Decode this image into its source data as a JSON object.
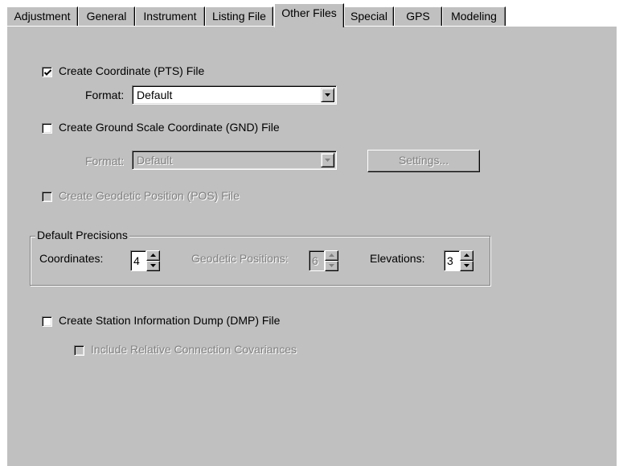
{
  "tabs": [
    {
      "label": "Adjustment"
    },
    {
      "label": "General"
    },
    {
      "label": "Instrument"
    },
    {
      "label": "Listing File"
    },
    {
      "label": "Other Files"
    },
    {
      "label": "Special"
    },
    {
      "label": "GPS"
    },
    {
      "label": "Modeling"
    }
  ],
  "active_tab": "Other Files",
  "pts": {
    "label": "Create Coordinate (PTS) File",
    "checked": true,
    "format_label": "Format:",
    "format_value": "Default"
  },
  "gnd": {
    "label": "Create Ground Scale Coordinate (GND) File",
    "checked": false,
    "format_label": "Format:",
    "format_value": "Default",
    "settings_label": "Settings..."
  },
  "pos": {
    "label": "Create Geodetic Position (POS) File",
    "checked": false,
    "disabled": true
  },
  "precisions": {
    "legend": "Default Precisions",
    "coordinates_label": "Coordinates:",
    "coordinates_value": "4",
    "geodetic_label": "Geodetic Positions:",
    "geodetic_value": "6",
    "elevations_label": "Elevations:",
    "elevations_value": "3"
  },
  "dmp": {
    "label": "Create Station Information Dump (DMP) File",
    "checked": false,
    "include_label": "Include Relative Connection Covariances",
    "include_checked": false
  },
  "colors": {
    "face": "#c0c0c0",
    "highlight": "#ffffff",
    "shadow": "#808080",
    "dark_shadow": "#000000",
    "disabled_text": "#808080"
  },
  "icons": {
    "checkmark": "check-icon",
    "dropdown": "down-arrow-icon",
    "spin_up": "up-arrow-icon",
    "spin_down": "down-arrow-icon"
  }
}
